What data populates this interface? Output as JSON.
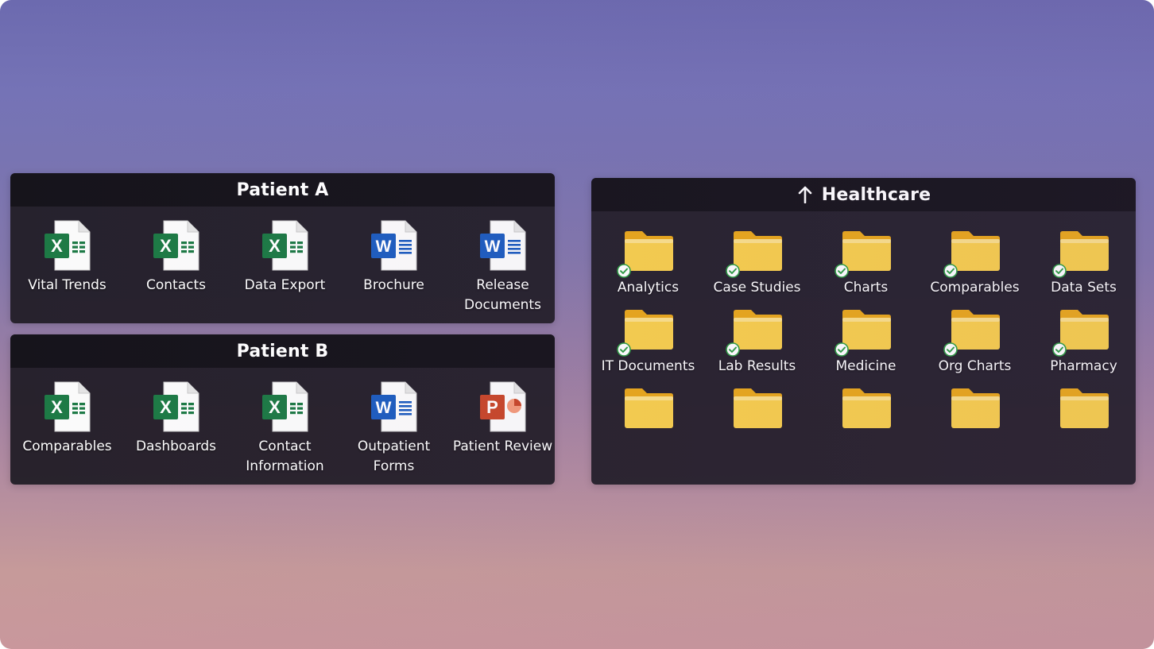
{
  "fences": [
    {
      "title": "Patient A",
      "items": [
        {
          "label": "Vital Trends",
          "icon": "excel-icon"
        },
        {
          "label": "Contacts",
          "icon": "excel-icon"
        },
        {
          "label": "Data Export",
          "icon": "excel-icon"
        },
        {
          "label": "Brochure",
          "icon": "word-icon"
        },
        {
          "label": "Release Documents",
          "icon": "word-icon"
        }
      ]
    },
    {
      "title": "Patient B",
      "items": [
        {
          "label": "Comparables",
          "icon": "excel-icon"
        },
        {
          "label": "Dashboards",
          "icon": "excel-icon"
        },
        {
          "label": "Contact Information",
          "icon": "excel-icon"
        },
        {
          "label": "Outpatient Forms",
          "icon": "word-icon"
        },
        {
          "label": "Patient Review",
          "icon": "powerpoint-icon"
        }
      ]
    },
    {
      "title": "Healthcare",
      "header_icon": "up-arrow-icon",
      "items": [
        {
          "label": "Analytics",
          "icon": "folder-icon",
          "synced": true
        },
        {
          "label": "Case Studies",
          "icon": "folder-icon",
          "synced": true
        },
        {
          "label": "Charts",
          "icon": "folder-icon",
          "synced": true
        },
        {
          "label": "Comparables",
          "icon": "folder-icon",
          "synced": true
        },
        {
          "label": "Data Sets",
          "icon": "folder-icon",
          "synced": true
        },
        {
          "label": "IT Documents",
          "icon": "folder-icon",
          "synced": true
        },
        {
          "label": "Lab Results",
          "icon": "folder-icon",
          "synced": true
        },
        {
          "label": "Medicine",
          "icon": "folder-icon",
          "synced": true
        },
        {
          "label": "Org Charts",
          "icon": "folder-icon",
          "synced": true
        },
        {
          "label": "Pharmacy",
          "icon": "folder-icon",
          "synced": true
        },
        {
          "label": "",
          "icon": "folder-icon",
          "synced": false
        },
        {
          "label": "",
          "icon": "folder-icon",
          "synced": false
        },
        {
          "label": "",
          "icon": "folder-icon",
          "synced": false
        },
        {
          "label": "",
          "icon": "folder-icon",
          "synced": false
        },
        {
          "label": "",
          "icon": "folder-icon",
          "synced": false
        }
      ]
    }
  ],
  "colors": {
    "excel": "#1d7a45",
    "word": "#1e5dbf",
    "powerpoint": "#c8472a",
    "folder": "#f7c843",
    "sync": "#2f9e44",
    "header_bg": "#16141b",
    "fence_bg": "#221e28"
  }
}
